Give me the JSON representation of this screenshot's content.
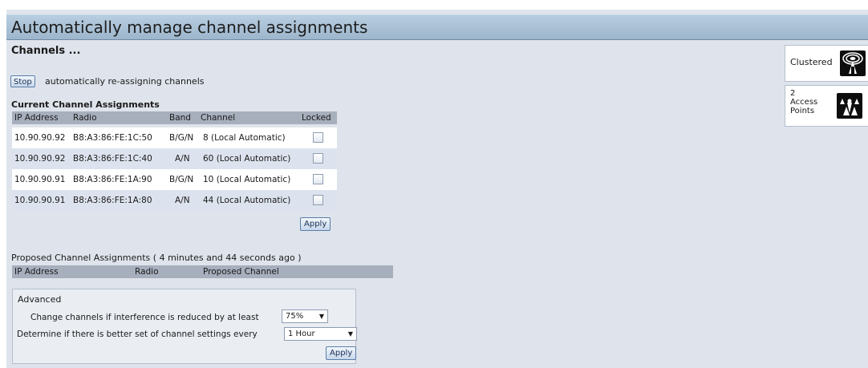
{
  "header": {
    "title": "Automatically manage channel assignments"
  },
  "channels": {
    "title": "Channels ...",
    "stop_label": "Stop",
    "stop_text": "automatically re-assigning channels"
  },
  "current": {
    "label": "Current Channel Assignments",
    "columns": [
      "IP Address",
      "Radio",
      "Band",
      "Channel",
      "Locked"
    ],
    "rows": [
      {
        "ip": "10.90.90.92",
        "radio": "B8:A3:86:FE:1C:50",
        "band": "B/G/N",
        "channel": "8 (Local Automatic)",
        "locked": false
      },
      {
        "ip": "10.90.90.92",
        "radio": "B8:A3:86:FE:1C:40",
        "band": "A/N",
        "channel": "60 (Local Automatic)",
        "locked": false
      },
      {
        "ip": "10.90.90.91",
        "radio": "B8:A3:86:FE:1A:90",
        "band": "B/G/N",
        "channel": "10 (Local Automatic)",
        "locked": false
      },
      {
        "ip": "10.90.90.91",
        "radio": "B8:A3:86:FE:1A:80",
        "band": "A/N",
        "channel": "44 (Local Automatic)",
        "locked": false
      }
    ],
    "apply_label": "Apply"
  },
  "proposed": {
    "label": "Proposed Channel Assignments ( 4 minutes and 44 seconds ago )",
    "columns": [
      "IP Address",
      "Radio",
      "Proposed Channel"
    ]
  },
  "advanced": {
    "title": "Advanced",
    "interference_label": "Change channels if interference is reduced by at least",
    "interference_value": "75%",
    "interval_label": "Determine if there is better set of channel settings every",
    "interval_value": "1 Hour",
    "apply_label": "Apply"
  },
  "sidebar": {
    "clustered_label": "Clustered",
    "ap_count": "2",
    "ap_label": "Access Points"
  },
  "colors": {
    "header_bg": "#a9c0d6",
    "page_bg": "#dfe4ec",
    "table_header_bg": "#a7afbd",
    "row_alt_bg": "#dde3ee",
    "button_border": "#5a7ea8"
  },
  "icons": [
    "clustered-icon",
    "access-points-icon",
    "dropdown-arrow-icon"
  ]
}
